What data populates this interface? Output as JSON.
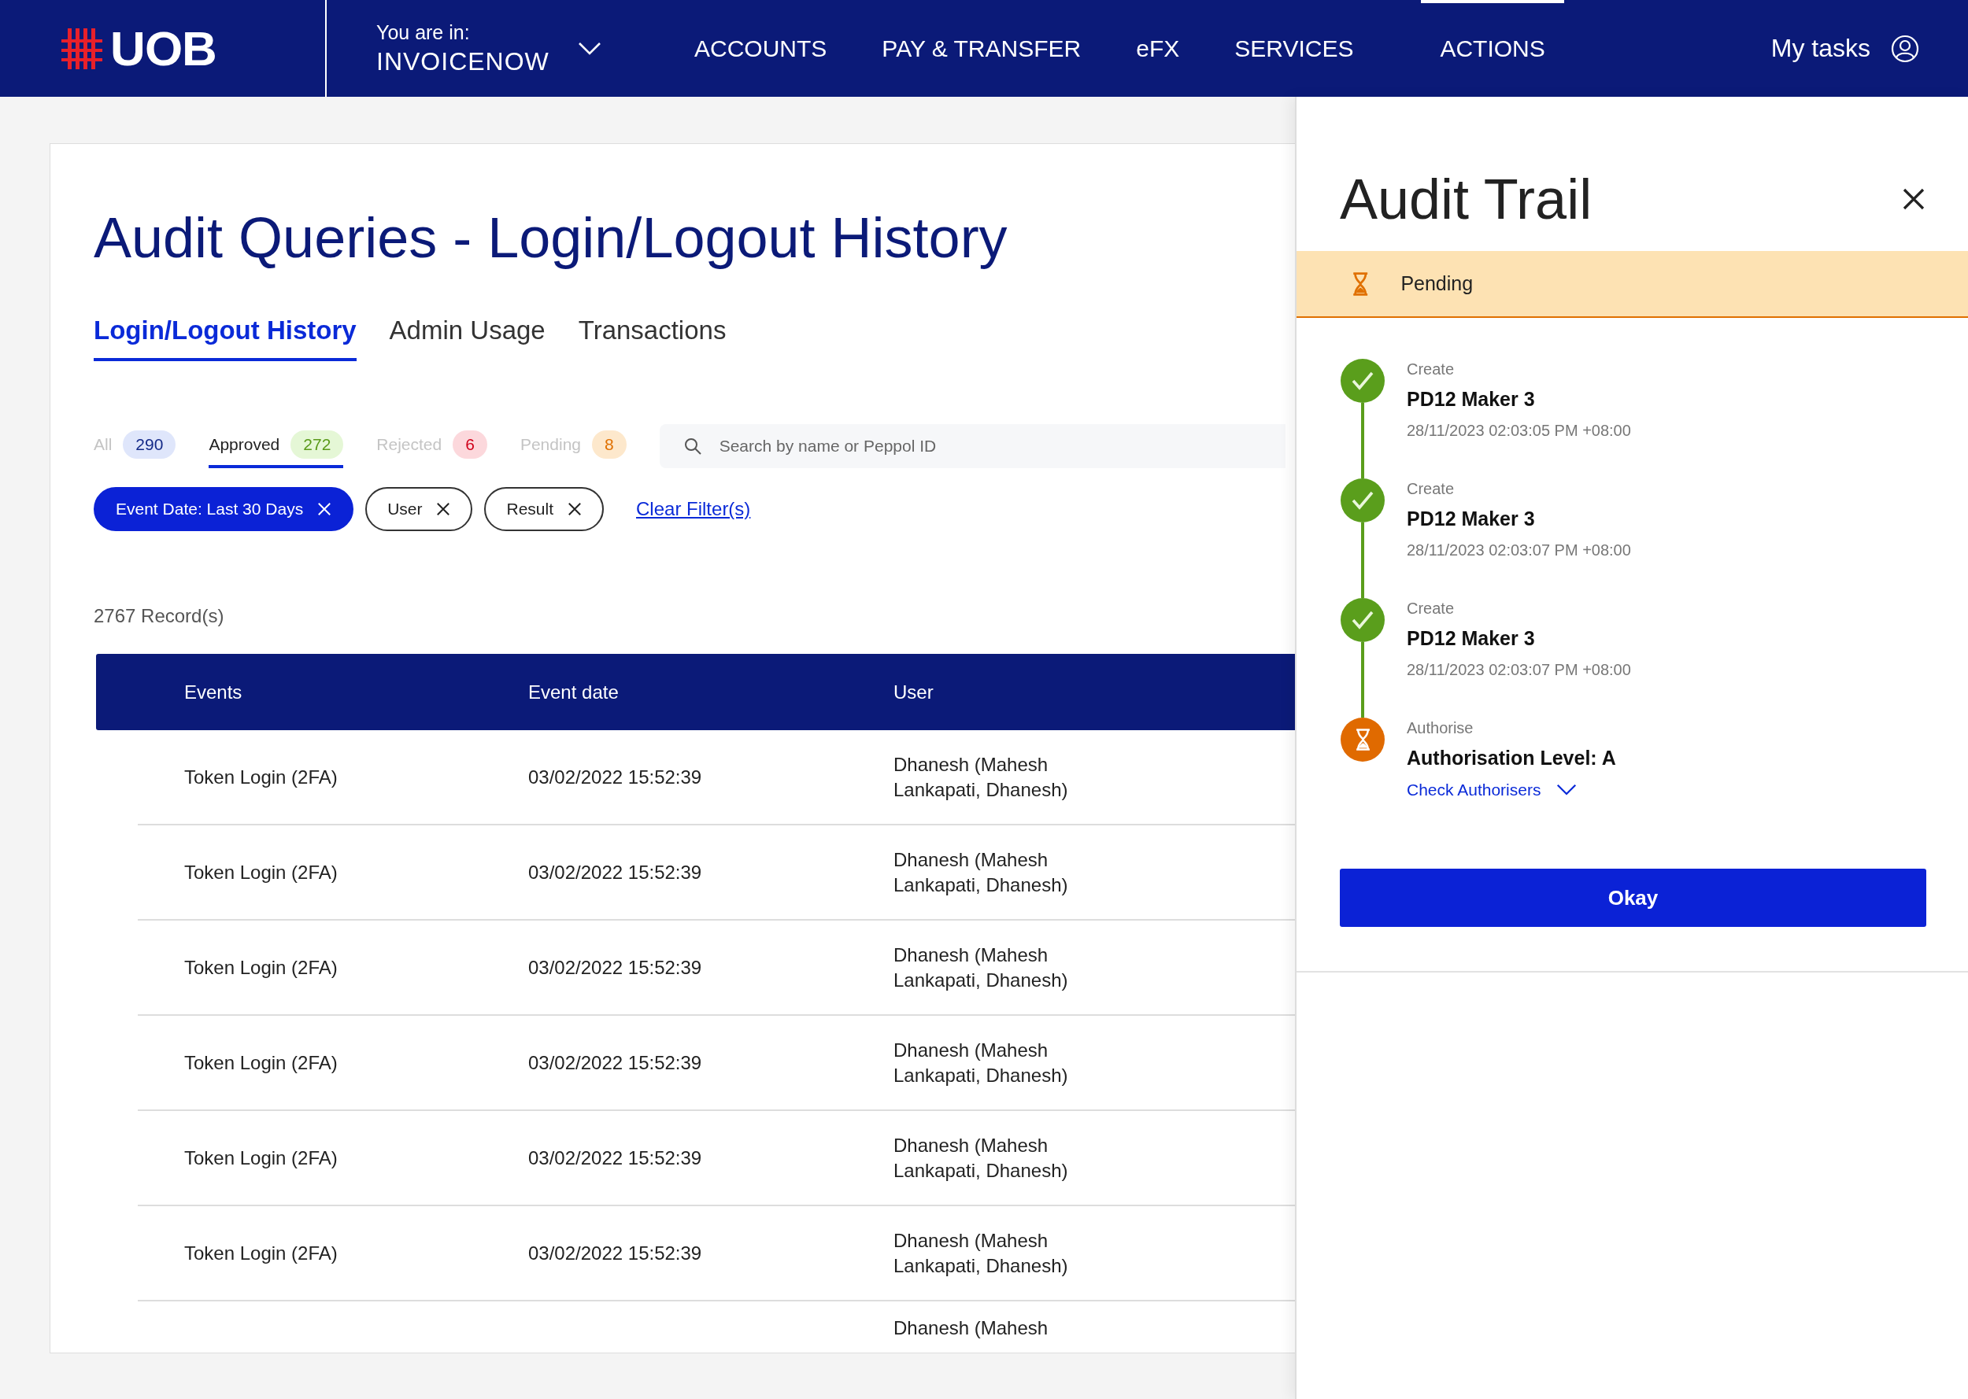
{
  "header": {
    "logo": "UOB",
    "context_label": "You are in:",
    "context_value": "INVOICENOW",
    "nav": [
      {
        "label": "ACCOUNTS",
        "selected": false
      },
      {
        "label": "PAY & TRANSFER",
        "selected": false
      },
      {
        "label": "eFX",
        "selected": false
      },
      {
        "label": "SERVICES",
        "selected": false
      },
      {
        "label": "ACTIONS",
        "selected": true
      }
    ],
    "my_tasks": "My tasks"
  },
  "page": {
    "title": "Audit Queries - Login/Logout History",
    "tabs": [
      {
        "label": "Login/Logout History",
        "selected": true
      },
      {
        "label": "Admin Usage",
        "selected": false
      },
      {
        "label": "Transactions",
        "selected": false
      }
    ],
    "status_filters": [
      {
        "label": "All",
        "count": "290",
        "selected": false,
        "color": "#dfe6fb"
      },
      {
        "label": "Approved",
        "count": "272",
        "selected": true,
        "color": "#e5f7d6"
      },
      {
        "label": "Rejected",
        "count": "6",
        "selected": false,
        "color": "#fcd8dc"
      },
      {
        "label": "Pending",
        "count": "8",
        "selected": false,
        "color": "#fde8cc"
      }
    ],
    "search": {
      "placeholder": "Search by name or Peppol ID"
    },
    "chips": [
      {
        "label": "Event Date: Last 30 Days",
        "active": true
      },
      {
        "label": "User",
        "active": false
      },
      {
        "label": "Result",
        "active": false
      }
    ],
    "clear_filters": "Clear Filter(s)",
    "records": "2767 Record(s)",
    "table": {
      "columns": [
        "Events",
        "Event date",
        "User"
      ],
      "rows": [
        {
          "events": "Token Login (2FA)",
          "event_date": "03/02/2022 15:52:39",
          "user": "Dhanesh (Mahesh Lankapati, Dhanesh)"
        },
        {
          "events": "Token Login (2FA)",
          "event_date": "03/02/2022 15:52:39",
          "user": "Dhanesh (Mahesh Lankapati, Dhanesh)"
        },
        {
          "events": "Token Login (2FA)",
          "event_date": "03/02/2022 15:52:39",
          "user": "Dhanesh (Mahesh Lankapati, Dhanesh)"
        },
        {
          "events": "Token Login (2FA)",
          "event_date": "03/02/2022 15:52:39",
          "user": "Dhanesh (Mahesh Lankapati, Dhanesh)"
        },
        {
          "events": "Token Login (2FA)",
          "event_date": "03/02/2022 15:52:39",
          "user": "Dhanesh (Mahesh Lankapati, Dhanesh)"
        },
        {
          "events": "Token Login (2FA)",
          "event_date": "03/02/2022 15:52:39",
          "user": "Dhanesh (Mahesh Lankapati, Dhanesh)"
        },
        {
          "user": "Dhanesh (Mahesh"
        }
      ]
    }
  },
  "audit_panel": {
    "title": "Audit Trail",
    "status": {
      "kind": "pending",
      "label": "Pending"
    },
    "timeline": [
      {
        "kind": "done",
        "action": "Create",
        "name": "PD12 Maker 3",
        "timestamp": "28/11/2023 02:03:05 PM +08:00"
      },
      {
        "kind": "done",
        "action": "Create",
        "name": "PD12 Maker 3",
        "timestamp": "28/11/2023 02:03:07 PM +08:00"
      },
      {
        "kind": "done",
        "action": "Create",
        "name": "PD12 Maker 3",
        "timestamp": "28/11/2023 02:03:07 PM +08:00"
      },
      {
        "kind": "pending",
        "action": "Authorise",
        "name": "Authorisation Level: A",
        "link": "Check Authorisers"
      }
    ],
    "button": "Okay"
  }
}
